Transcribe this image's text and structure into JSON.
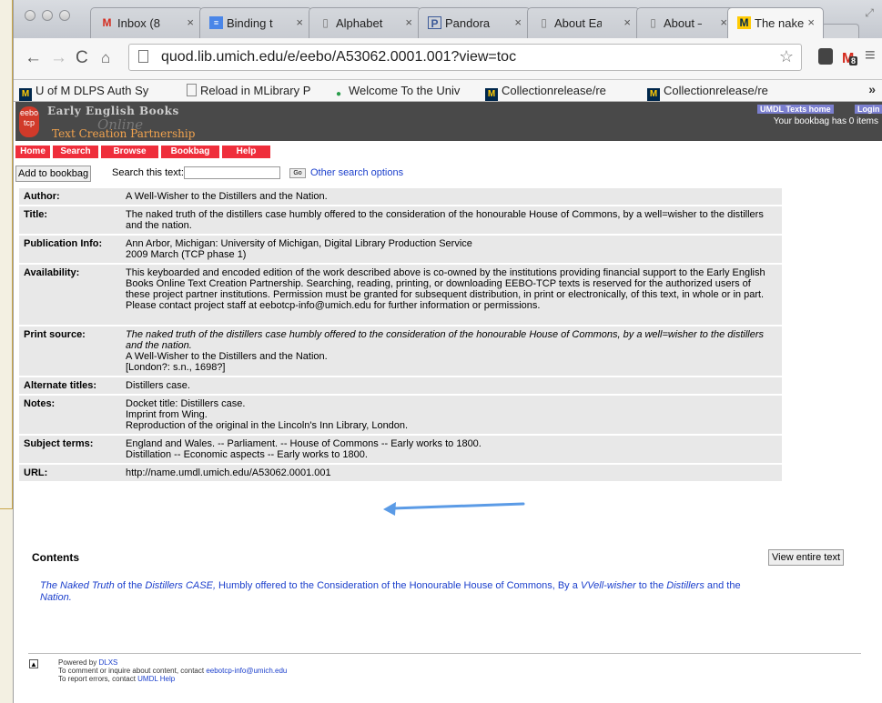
{
  "browser": {
    "tabs": [
      {
        "label": "Inbox (8",
        "icon": "gmail-icon"
      },
      {
        "label": "Binding t",
        "icon": "docs-icon"
      },
      {
        "label": "Alphabet",
        "icon": "page-icon"
      },
      {
        "label": "Pandora",
        "icon": "pandora-icon"
      },
      {
        "label": "About Ea",
        "icon": "page-icon"
      },
      {
        "label": "About –",
        "icon": "page-icon"
      },
      {
        "label": "The nake",
        "icon": "umich-icon"
      }
    ],
    "url": "quod.lib.umich.edu/e/eebo/A53062.0001.001?view=toc",
    "extension_badge": "8",
    "bookmarks": [
      {
        "label": "U of M DLPS Auth Sy",
        "icon": "umich-icon"
      },
      {
        "label": "Reload in MLibrary P",
        "icon": "page-icon"
      },
      {
        "label": "Welcome To the Univ",
        "icon": "globe-icon"
      },
      {
        "label": "Collectionrelease/re",
        "icon": "umich-icon"
      },
      {
        "label": "Collectionrelease/re",
        "icon": "umich-icon"
      }
    ]
  },
  "site": {
    "logo_title": "Early English Books",
    "logo_online": "Online",
    "logo_sub": "Text Creation Partnership",
    "logo_badge": "eebo tcp",
    "umdl_home": "UMDL Texts home",
    "login": "Login",
    "bookbag_status": "Your bookbag has 0 items",
    "nav": [
      "Home",
      "Search",
      "Browse",
      "Bookbag",
      "Help"
    ]
  },
  "search": {
    "add_button": "Add to bookbag",
    "label": "Search this text:",
    "value": "",
    "go": "Go",
    "other_link": "Other search options"
  },
  "record": {
    "author_label": "Author:",
    "author": "A Well-Wisher to the Distillers and the Nation.",
    "title_label": "Title:",
    "title": "The naked truth of the distillers case humbly offered to the consideration of the honourable House of Commons, by a well=wisher to the distillers and the nation.",
    "pub_label": "Publication Info:",
    "pub_line1": "Ann Arbor, Michigan: University of Michigan, Digital Library Production Service",
    "pub_line2": "2009 March (TCP phase 1)",
    "avail_label": "Availability:",
    "availability": "This keyboarded and encoded edition of the work described above is co-owned by the institutions providing financial support to the Early English Books Online Text Creation Partnership. Searching, reading, printing, or downloading EEBO-TCP texts is reserved for the authorized users of these project partner institutions. Permission must be granted for subsequent distribution, in print or electronically, of this text, in whole or in part. Please contact project staff at eebotcp-info@umich.edu for further information or permissions.",
    "print_label": "Print source:",
    "print_title": "The naked truth of the distillers case humbly offered to the consideration of the honourable House of Commons, by a well=wisher to the distillers and the nation.",
    "print_author": "A Well-Wisher to the Distillers and the Nation.",
    "print_imprint": "[London?: s.n., 1698?]",
    "alt_label": "Alternate titles:",
    "alt_titles": "Distillers case.",
    "notes_label": "Notes:",
    "notes": [
      "Docket title: Distillers case.",
      "Imprint from Wing.",
      "Reproduction of the original in the Lincoln's Inn Library, London."
    ],
    "subject_label": "Subject terms:",
    "subjects": [
      "England and Wales. -- Parliament. -- House of Commons -- Early works to 1800.",
      "Distillation -- Economic aspects -- Early works to 1800."
    ],
    "url_label": "URL:",
    "url": "http://name.umdl.umich.edu/A53062.0001.001"
  },
  "contents": {
    "heading": "Contents",
    "view_entire": "View entire text",
    "toc": {
      "p1": "The Naked Truth",
      "p2": " of the ",
      "p3": "Distillers CASE,",
      "p4": " Humbly offered to the Consideration of the Honourable House of Commons, By a ",
      "p5": "VVell-wisher",
      "p6": " to the ",
      "p7": "Distillers",
      "p8": " and the ",
      "p9": "Nation."
    }
  },
  "footer": {
    "powered": "Powered by ",
    "dlxs": "DLXS",
    "comment": "To comment or inquire about content, contact ",
    "email": "eebotcp-info@umich.edu",
    "errors": "To report errors, contact ",
    "umdl_help": "UMDL Help"
  },
  "colors": {
    "red_nav": "#ef2e3b",
    "banner": "#494949",
    "link": "#1b3fcc",
    "arrow": "#5b9be6"
  }
}
